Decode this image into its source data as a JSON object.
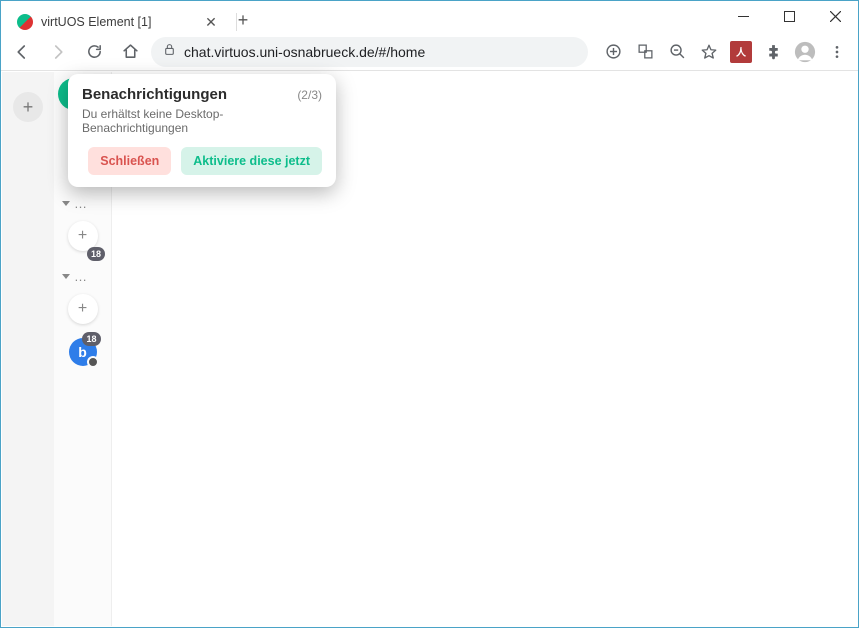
{
  "browser": {
    "tab_title": "virtUOS Element [1]",
    "url": "chat.virtuos.uni-osnabrueck.de/#/home"
  },
  "sidebar": {
    "badge1": "18",
    "badge2": "18",
    "room_letter": "b"
  },
  "toast": {
    "title": "Benachrichtigungen",
    "count": "(2/3)",
    "message": "Du erhältst keine Desktop-Benachrichtigungen",
    "close_label": "Schließen",
    "activate_label": "Aktiviere diese jetzt"
  }
}
